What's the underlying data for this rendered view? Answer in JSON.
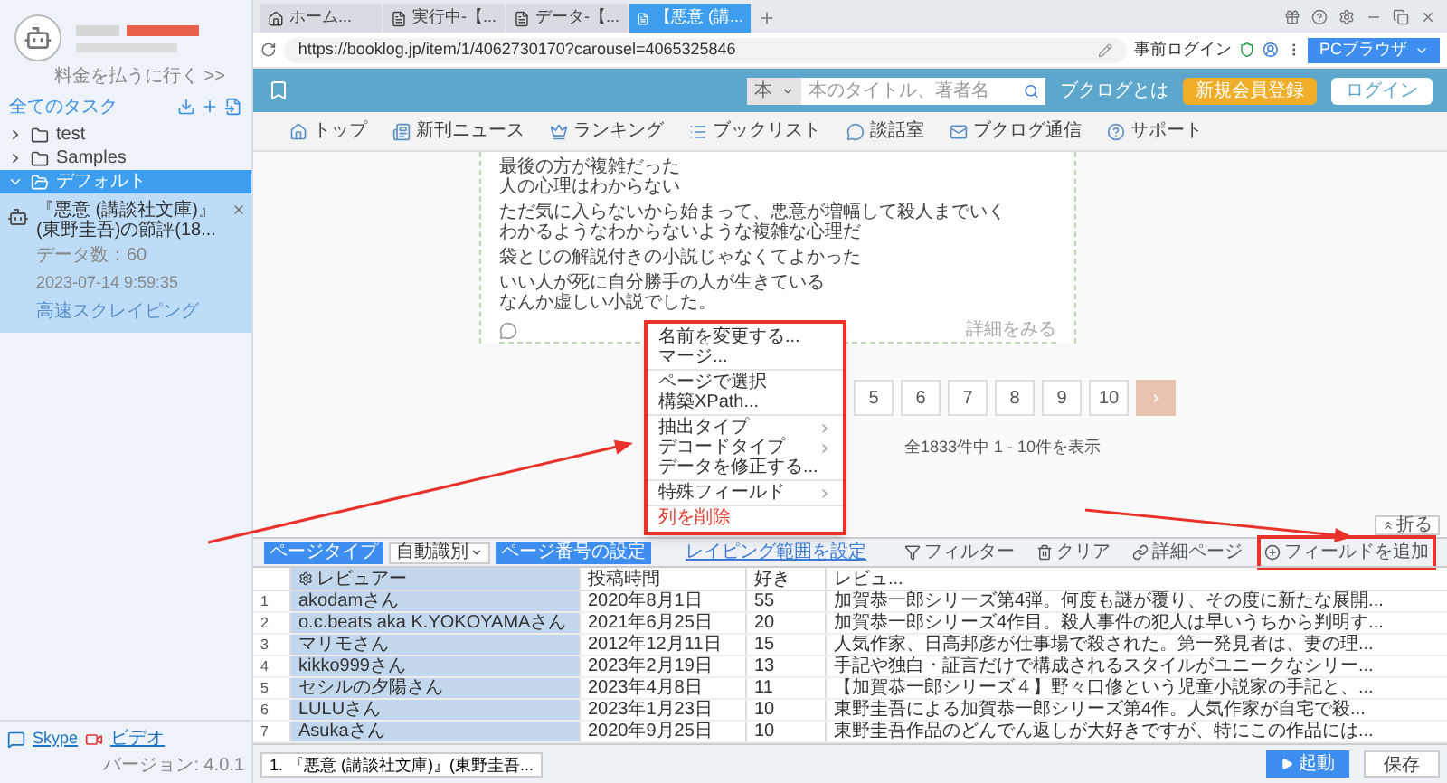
{
  "sidebar": {
    "upgrade_link": "料金を払うに行く >>",
    "tasks_header": "全てのタスク",
    "folders": [
      {
        "name": "test",
        "expanded": false,
        "selected": false
      },
      {
        "name": "Samples",
        "expanded": false,
        "selected": false
      },
      {
        "name": "デフォルト",
        "expanded": true,
        "selected": true,
        "tasks": [
          {
            "title": "『悪意 (講談社文庫)』(東野圭吾)の節評(18...",
            "count_label": "データ数：60",
            "time": "2023-07-14 9:59:35",
            "mode": "高速スクレイピング"
          }
        ]
      }
    ],
    "footer": {
      "skype": "Skype",
      "video": "ビデオ",
      "version": "バージョン: 4.0.1"
    }
  },
  "browser": {
    "tabs": [
      {
        "label": "ホーム...",
        "kind": "home",
        "selected": false
      },
      {
        "label": "実行中-【...",
        "kind": "page",
        "selected": false
      },
      {
        "label": "データ-【...",
        "kind": "page",
        "selected": false
      },
      {
        "label": "【悪意 (講...",
        "kind": "page",
        "selected": true
      }
    ],
    "url": "https://booklog.jp/item/1/4062730170?carousel=4065325846",
    "prelogin": "事前ログイン",
    "mode_button": "PCブラウザ"
  },
  "site": {
    "search": {
      "category": "本",
      "placeholder": "本のタイトル、著者名"
    },
    "about": "ブクログとは",
    "signup": "新規会員登録",
    "login": "ログイン",
    "nav": [
      {
        "label": "トップ",
        "kind": "home"
      },
      {
        "label": "新刊ニュース",
        "kind": "news"
      },
      {
        "label": "ランキング",
        "kind": "ranking"
      },
      {
        "label": "ブックリスト",
        "kind": "list"
      },
      {
        "label": "談話室",
        "kind": "chat"
      },
      {
        "label": "ブクログ通信",
        "kind": "mail"
      },
      {
        "label": "サポート",
        "kind": "help"
      }
    ]
  },
  "review": {
    "paragraphs": [
      [
        "最後の方が複雑だった",
        "人の心理はわからない"
      ],
      [
        "ただ気に入らないから始まって、悪意が増幅して殺人までいく",
        "わかるようなわからないような複雑な心理だ"
      ],
      [
        "袋とじの解説付きの小説じゃなくてよかった"
      ],
      [
        "いい人が死に自分勝手の人が生きている",
        "なんか虚しい小説でした。"
      ]
    ],
    "more": "詳細をみる"
  },
  "pagination": {
    "pages": [
      {
        "label": "5",
        "selected": false
      },
      {
        "label": "6",
        "selected": false
      },
      {
        "label": "7",
        "selected": false
      },
      {
        "label": "8",
        "selected": false
      },
      {
        "label": "9",
        "selected": false
      },
      {
        "label": "10",
        "selected": false
      }
    ],
    "next": "›",
    "summary": "全1833件中 1 - 10件を表示"
  },
  "context_menu": {
    "highlighted": true,
    "groups": [
      [
        {
          "label": "名前を変更する...",
          "kind": "item"
        },
        {
          "label": "マージ...",
          "kind": "item"
        }
      ],
      [
        {
          "label": "ページで選択",
          "kind": "item"
        },
        {
          "label": "構築XPath...",
          "kind": "item"
        }
      ],
      [
        {
          "label": "抽出タイプ",
          "kind": "submenu"
        },
        {
          "label": "デコードタイプ",
          "kind": "submenu"
        },
        {
          "label": "データを修正する...",
          "kind": "item"
        }
      ],
      [
        {
          "label": "特殊フィールド",
          "kind": "submenu"
        }
      ],
      [
        {
          "label": "列を削除",
          "kind": "danger"
        }
      ]
    ]
  },
  "collapse_button": "折る",
  "toolbar": {
    "page_type_label": "ページタイプ",
    "page_type_value": "自動識別",
    "page_number_button": "ページ番号の設定",
    "range_link": "レイピング範囲を設定",
    "actions": [
      {
        "label": "フィルター",
        "kind": "filter",
        "highlighted": false
      },
      {
        "label": "クリア",
        "kind": "clear",
        "highlighted": false
      },
      {
        "label": "詳細ページ",
        "kind": "link",
        "highlighted": false
      },
      {
        "label": "フィールドを追加",
        "kind": "add",
        "highlighted": true
      }
    ]
  },
  "table": {
    "columns": [
      {
        "label": "レビュアー",
        "selected": true
      },
      {
        "label": "投稿時間",
        "selected": false
      },
      {
        "label": "好き",
        "selected": false
      },
      {
        "label": "レビュ...",
        "selected": false
      }
    ],
    "rows": [
      {
        "index": "1",
        "cells": [
          "akodamさん",
          "2020年8月1日",
          "55",
          "加賀恭一郎シリーズ第4弾。何度も謎が覆り、その度に新たな展開..."
        ]
      },
      {
        "index": "2",
        "cells": [
          "o.c.beats aka K.YOKOYAMAさん",
          "2021年6月25日",
          "20",
          "加賀恭一郎シリーズ4作目。殺人事件の犯人は早いうちから判明す..."
        ]
      },
      {
        "index": "3",
        "cells": [
          "マリモさん",
          "2012年12月11日",
          "15",
          "人気作家、日高邦彦が仕事場で殺された。第一発見者は、妻の理..."
        ]
      },
      {
        "index": "4",
        "cells": [
          "kikko999さん",
          "2023年2月19日",
          "13",
          "手記や独白・証言だけで構成されるスタイルがユニークなシリー..."
        ]
      },
      {
        "index": "5",
        "cells": [
          "セシルの夕陽さん",
          "2023年4月8日",
          "11",
          "【加賀恭一郎シリーズ４】野々口修という児童小説家の手記と、..."
        ]
      },
      {
        "index": "6",
        "cells": [
          "LULUさん",
          "2023年1月23日",
          "10",
          "東野圭吾による加賀恭一郎シリーズ第4作。人気作家が自宅で殺..."
        ]
      },
      {
        "index": "7",
        "cells": [
          "Asukaさん",
          "2020年9月25日",
          "10",
          "東野圭吾作品のどんでん返しが大好きですが、特にこの作品には..."
        ]
      }
    ]
  },
  "bottom_bar": {
    "task_tab": "1. 『悪意 (講談社文庫)』(東野圭吾...",
    "start": "起動",
    "save": "保存"
  }
}
